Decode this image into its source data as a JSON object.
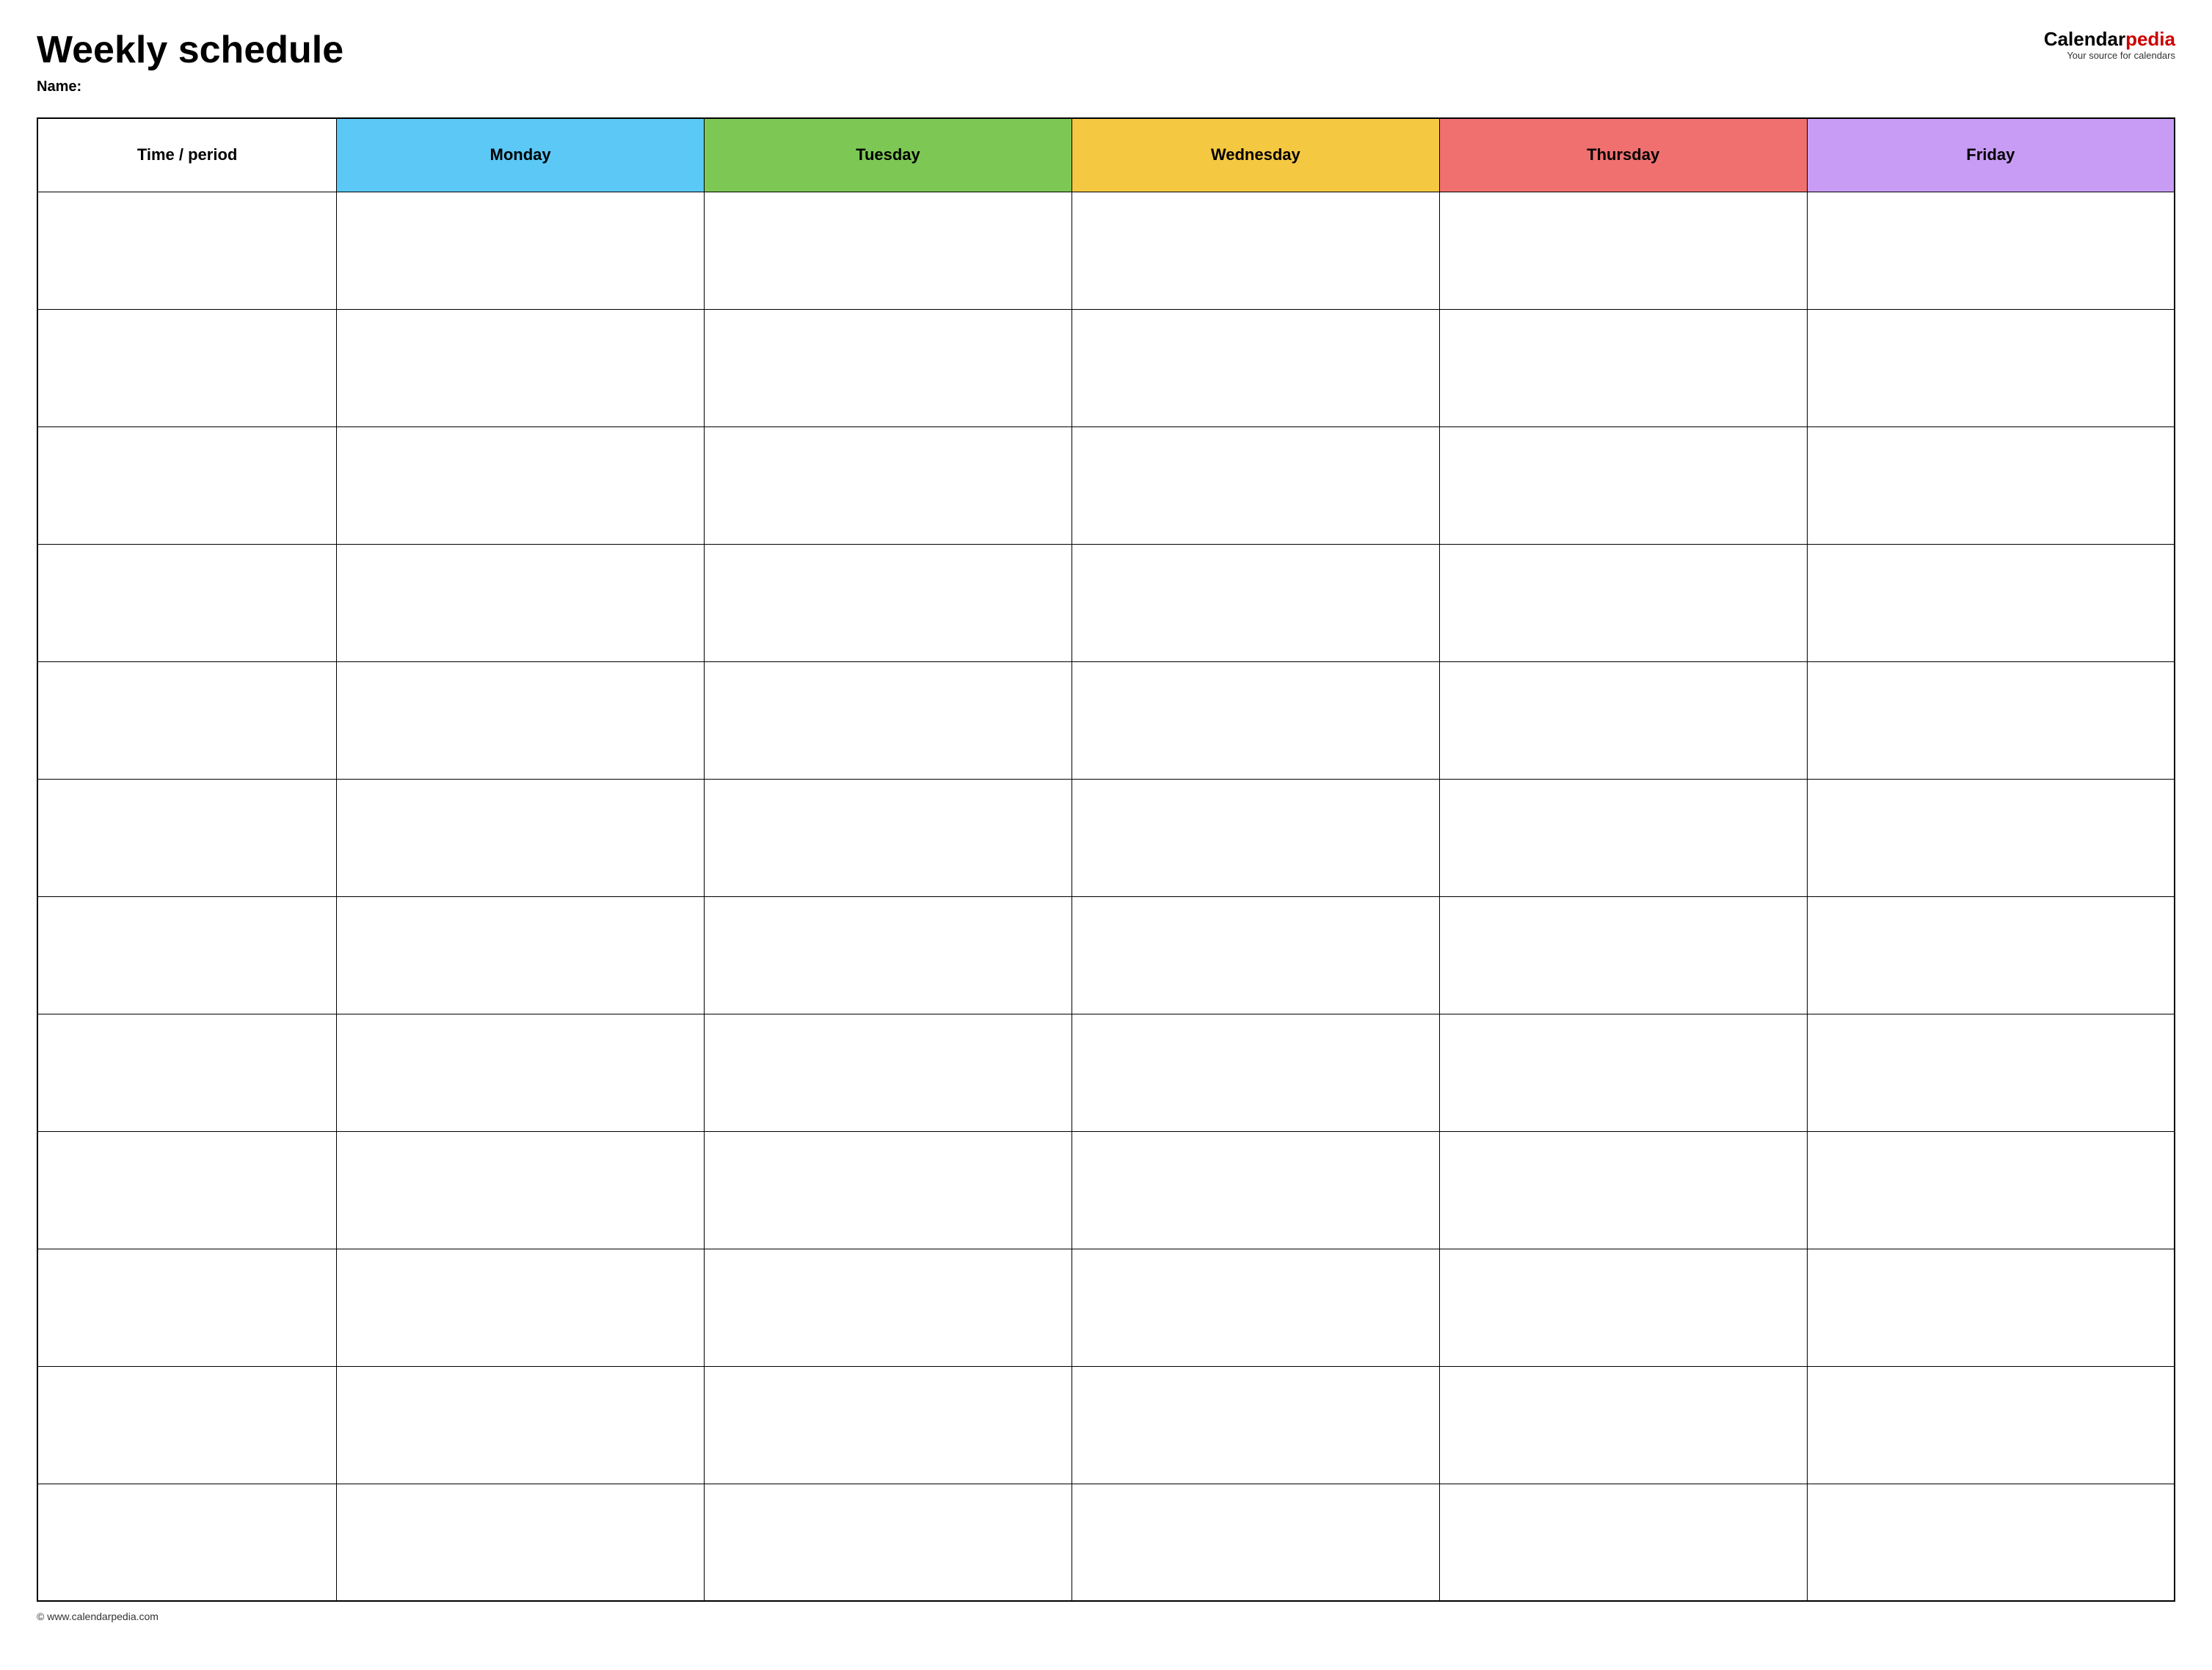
{
  "header": {
    "title": "Weekly schedule",
    "name_label": "Name:",
    "logo": {
      "calendar_part": "Calendar",
      "pedia_part": "pedia",
      "tagline": "Your source for calendars"
    }
  },
  "table": {
    "columns": [
      {
        "key": "time",
        "label": "Time / period",
        "class": "th-time"
      },
      {
        "key": "monday",
        "label": "Monday",
        "class": "th-monday"
      },
      {
        "key": "tuesday",
        "label": "Tuesday",
        "class": "th-tuesday"
      },
      {
        "key": "wednesday",
        "label": "Wednesday",
        "class": "th-wednesday"
      },
      {
        "key": "thursday",
        "label": "Thursday",
        "class": "th-thursday"
      },
      {
        "key": "friday",
        "label": "Friday",
        "class": "th-friday"
      }
    ],
    "row_count": 12
  },
  "footer": {
    "url": "© www.calendarpedia.com"
  }
}
